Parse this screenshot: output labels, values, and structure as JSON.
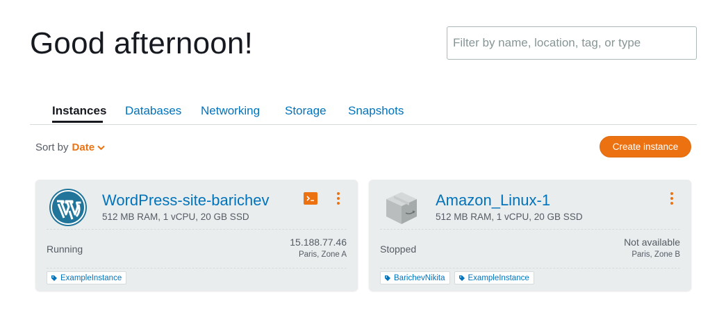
{
  "greeting": "Good afternoon!",
  "filter": {
    "placeholder": "Filter by name, location, tag, or type",
    "value": ""
  },
  "tabs": [
    {
      "label": "Instances",
      "active": true
    },
    {
      "label": "Databases",
      "active": false
    },
    {
      "label": "Networking",
      "active": false
    },
    {
      "label": "Storage",
      "active": false
    },
    {
      "label": "Snapshots",
      "active": false
    }
  ],
  "sort": {
    "label": "Sort by",
    "value": "Date"
  },
  "create_button": "Create instance",
  "colors": {
    "accent": "#ec7211",
    "link": "#0073bb",
    "card_bg": "#eaeded"
  },
  "instances": [
    {
      "name": "WordPress-site-barichev",
      "specs": "512 MB RAM, 1 vCPU, 20 GB SSD",
      "status": "Running",
      "ip": "15.188.77.46",
      "zone": "Paris, Zone A",
      "icon": "wordpress-icon",
      "tags": [
        "ExampleInstance"
      ]
    },
    {
      "name": "Amazon_Linux-1",
      "specs": "512 MB RAM, 1 vCPU, 20 GB SSD",
      "status": "Stopped",
      "ip": "Not available",
      "zone": "Paris, Zone B",
      "icon": "amazon-linux-box-icon",
      "tags": [
        "BarichevNikita",
        "ExampleInstance"
      ]
    }
  ]
}
